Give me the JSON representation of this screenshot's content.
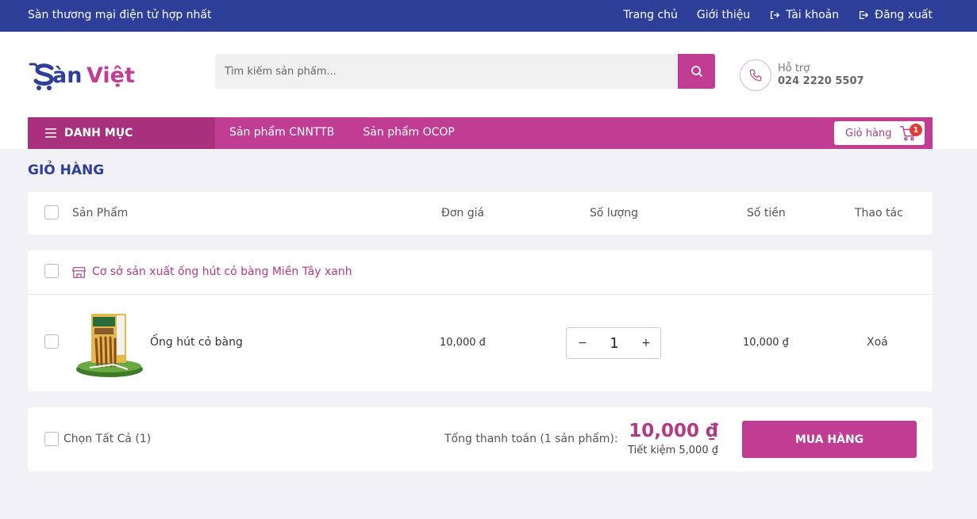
{
  "topbar": {
    "slogan": "Sàn thương mại điện tử hợp nhất",
    "links": [
      {
        "label": "Trang chủ"
      },
      {
        "label": "Giới thiệu"
      },
      {
        "label": "Tài khoản"
      },
      {
        "label": "Đăng xuất"
      }
    ]
  },
  "header": {
    "logo_text": "SànViệt",
    "search_placeholder": "Tìm kiếm sản phẩm...",
    "support_label": "Hỗ trợ",
    "support_phone": "024 2220 5507"
  },
  "nav": {
    "menu_label": "DANH MỤC",
    "links": [
      "Sản phẩm CNNTTB",
      "Sản phẩm OCOP"
    ],
    "cart_label": "Giỏ hàng",
    "cart_count": "1"
  },
  "cart": {
    "title": "GIỎ HÀNG",
    "columns": {
      "product": "Sản Phẩm",
      "unit_price": "Đơn giá",
      "quantity": "Số lượng",
      "amount": "Số tiền",
      "action": "Thao tác"
    },
    "shop_name": "Cơ sở sản xuất ống hút cỏ bàng Miền Tây xanh",
    "item": {
      "name": "Ống hút cỏ bàng",
      "price": "10,000 đ",
      "qty_minus": "−",
      "qty": "1",
      "qty_plus": "+",
      "subtotal": "10,000 ₫",
      "delete": "Xoá"
    },
    "footer": {
      "select_all": "Chọn Tất Cả (1)",
      "total_label": "Tổng thanh toán (1 sản phẩm):",
      "total_value": "10,000 ₫",
      "savings": "Tiết kiệm 5,000 ₫",
      "buy_label": "MUA HÀNG"
    }
  },
  "colors": {
    "primary_blue": "#2e3f9a",
    "accent_magenta": "#c13c93",
    "badge_red": "#e53935"
  }
}
